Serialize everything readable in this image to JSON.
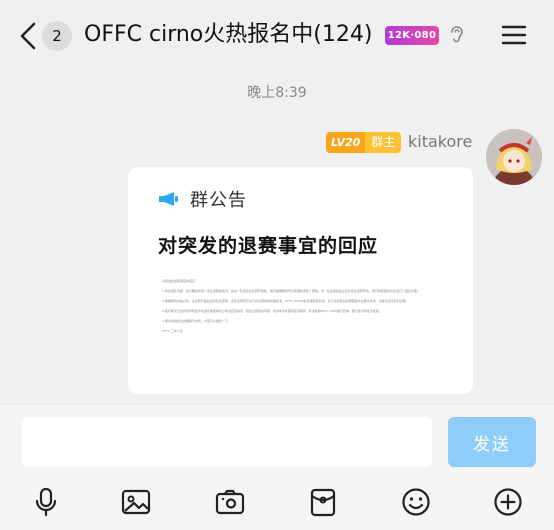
{
  "header": {
    "unread_count": "2",
    "title": "OFFC cirno火热报名中(124)",
    "title_tag": "12K·080",
    "icons": [
      "back-arrow-icon",
      "voice-icon",
      "menu-icon"
    ]
  },
  "messages": {
    "time_divider": "晚上8:39",
    "sender": {
      "level": "LV20",
      "role": "群主",
      "name": "kitakore"
    },
    "announcement": {
      "label": "群公告",
      "title": "对突发的退赛事宜的回应",
      "body": [
        "对突发的退赛事宜的回应:",
        "1.有关退队方面，我们确实有两个选队退赛的情况，其中一队发生在比赛开始前，我们根据规则予以受理并调整了赛程，另一队在报名截止后才提出退赛申请，我们依照报名协议进行了相应处理。",
        "2.根据规则中第六条，在比赛开始后如有队伍退赛，该队伍所有已进行的比赛成绩将被取消，OFFC Staff对此处理结果负责，并已将调整后的赛程发布在群文件中，请各位选手及时查看。",
        "3.我们希望日后所有参赛选手在报名前能够充分考虑自身情况，避免出现类似问题，如对本次处理有任何疑问，欢迎私聊OFFC Staff进行咨询，我们会尽快给予答复。",
        "4.再次感谢各位的理解与支持，大家可以继续一下。",
        "OFFC 工作人员"
      ]
    }
  },
  "input": {
    "placeholder": "",
    "value": "",
    "send_label": "发送"
  },
  "toolbar": {
    "items": [
      "microphone-icon",
      "image-icon",
      "camera-icon",
      "red-packet-icon",
      "emoji-icon",
      "plus-icon"
    ]
  },
  "colors": {
    "background": "#f0f0f0",
    "send_button": "#8ecdfa",
    "level_badge": "#f7a51b",
    "role_badge": "#fbc235",
    "megaphone": "#2fa8f4",
    "title_tag": "#c040c8"
  }
}
